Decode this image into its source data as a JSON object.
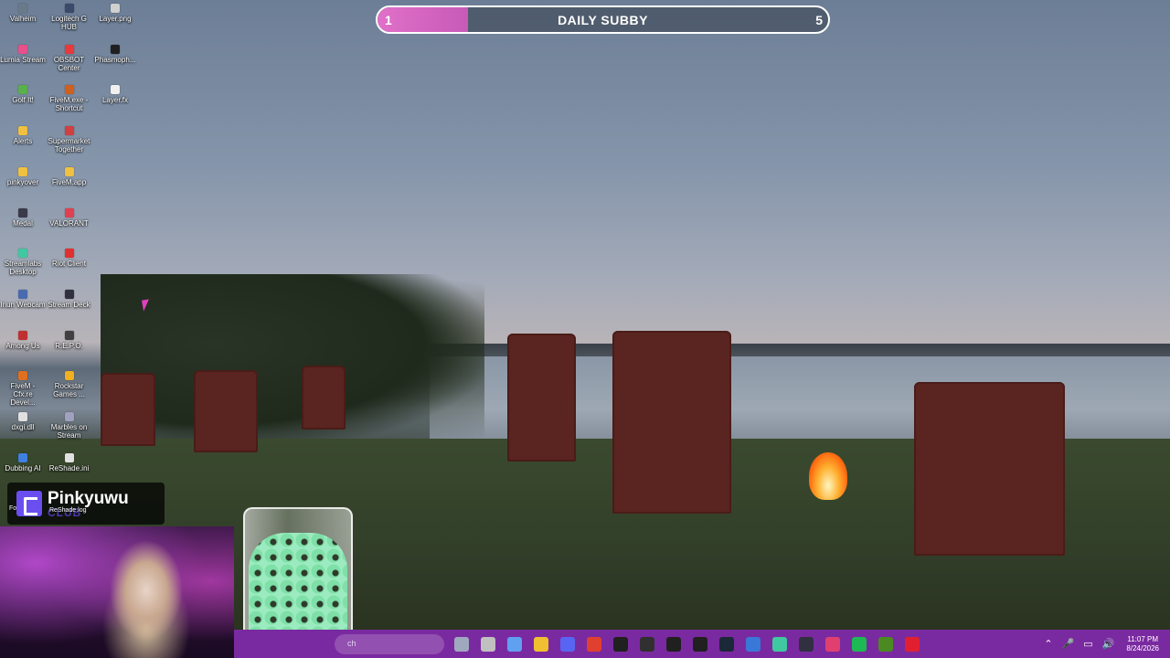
{
  "desktop_icons": [
    {
      "label": "Valheim",
      "color": "#6a7a8a"
    },
    {
      "label": "Logitech G HUB",
      "color": "#3a4a6a"
    },
    {
      "label": "Layer.png",
      "color": "#d0d0d0"
    },
    {
      "label": "Lumia Stream",
      "color": "#e8508a"
    },
    {
      "label": "OBSBOT Center",
      "color": "#e83a3a"
    },
    {
      "label": "Phasmoph...",
      "color": "#202020"
    },
    {
      "label": "Golf It!",
      "color": "#5ab04a"
    },
    {
      "label": "FiveM.exe - Shortcut",
      "color": "#d06020"
    },
    {
      "label": "Layer.fx",
      "color": "#f0f0f0"
    },
    {
      "label": "Alerts",
      "color": "#f0c040"
    },
    {
      "label": "Supermarket Together",
      "color": "#d04040"
    },
    {
      "label": "pinkyover",
      "color": "#f0c040"
    },
    {
      "label": "FiveM.app",
      "color": "#f0c040"
    },
    {
      "label": "Medal",
      "color": "#3a3a4a"
    },
    {
      "label": "VALORANT",
      "color": "#e04050"
    },
    {
      "label": "Streamlabs Desktop",
      "color": "#40c8a0"
    },
    {
      "label": "Riot Client",
      "color": "#e03030"
    },
    {
      "label": "Iriun Webcam",
      "color": "#4a6ab0"
    },
    {
      "label": "Stream Deck",
      "color": "#303040"
    },
    {
      "label": "Among Us",
      "color": "#c03030"
    },
    {
      "label": "R.E.P.O.",
      "color": "#404040"
    },
    {
      "label": "FiveM - Cfx.re Devel...",
      "color": "#e07020"
    },
    {
      "label": "Rockstar Games ...",
      "color": "#f0b020"
    },
    {
      "label": "dxgi.dll",
      "color": "#e0e0e0"
    },
    {
      "label": "Marbles on Stream",
      "color": "#a0a0c0"
    },
    {
      "label": "Dubbing AI",
      "color": "#4080e0"
    },
    {
      "label": "ReShade.ini",
      "color": "#e0e0e0"
    }
  ],
  "goal_bar": {
    "title": "DAILY SUBBY",
    "current": "1",
    "goal": "5",
    "progress": 0.2,
    "fill_color": "#e070c8"
  },
  "streamer": {
    "name": "Pinkyuwu",
    "tag": "CLUB",
    "overlay_prefix": "Fo",
    "overlay_file": "ReShade.log"
  },
  "taskbar": {
    "search_placeholder": "ch",
    "apps": [
      {
        "name": "widget-app",
        "color": "#a0a8c0"
      },
      {
        "name": "file-app",
        "color": "#c0c0c0"
      },
      {
        "name": "copilot-app",
        "color": "#60a0f0"
      },
      {
        "name": "explorer-app",
        "color": "#f0c030"
      },
      {
        "name": "discord-app",
        "color": "#5865f2"
      },
      {
        "name": "chrome-app",
        "color": "#e04030"
      },
      {
        "name": "capcut-app",
        "color": "#202020"
      },
      {
        "name": "obs-app",
        "color": "#303030"
      },
      {
        "name": "epic-app",
        "color": "#202020"
      },
      {
        "name": "ghub-app",
        "color": "#202020"
      },
      {
        "name": "steam-app",
        "color": "#1b2838"
      },
      {
        "name": "mail-app",
        "color": "#3a78d8"
      },
      {
        "name": "streamlabs-app",
        "color": "#40c8a0"
      },
      {
        "name": "streamdeck-app",
        "color": "#303040"
      },
      {
        "name": "maps-app",
        "color": "#e04070"
      },
      {
        "name": "spotify-app",
        "color": "#1db954"
      },
      {
        "name": "nvidia-app",
        "color": "#4a8a20"
      },
      {
        "name": "opera-app",
        "color": "#e02030"
      }
    ],
    "time": "11:07 PM",
    "date": "8/24/2026",
    "color": "#7a2aa0"
  }
}
